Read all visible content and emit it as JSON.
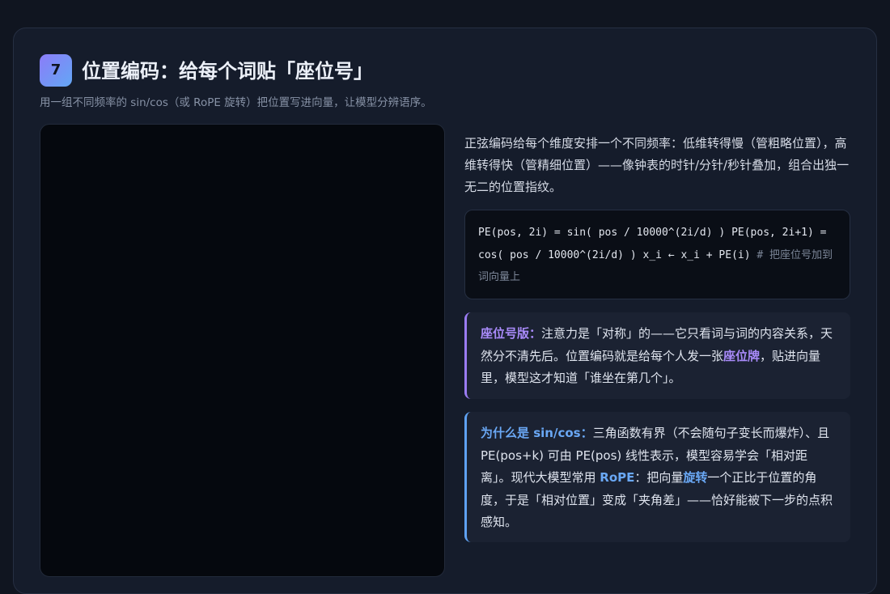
{
  "section": {
    "number": "7",
    "title": "位置编码：给每个词贴「座位号」",
    "subtitle": "用一组不同频率的 sin/cos（或 RoPE 旋转）把位置写进向量，让模型分辨语序。"
  },
  "intro_text": "正弦编码给每个维度安排一个不同频率：低维转得慢（管粗略位置），高维转得快（管精细位置）——像钟表的时针/分针/秒针叠加，组合出独一无二的位置指纹。",
  "code": {
    "formula": "PE(pos, 2i) = sin( pos / 10000^(2i/d) ) PE(pos, 2i+1) = cos( pos / 10000^(2i/d) ) x_i ← x_i + PE(i)",
    "comment": "# 把座位号加到词向量上"
  },
  "note_seat": {
    "label": "座位号版：",
    "text_1": "注意力是「对称」的——它只看词与词的内容关系，天然分不清先后。位置编码就是给每个人发一张",
    "highlight": "座位牌",
    "text_2": "，贴进向量里，模型这才知道「谁坐在第几个」。"
  },
  "note_why": {
    "label": "为什么是 sin/cos：",
    "text_1": "三角函数有界（不会随句子变长而爆炸）、且 PE(pos+k) 可由 PE(pos) 线性表示，模型容易学会「相对距离」。现代大模型常用 ",
    "highlight_rope": "RoPE",
    "text_2": "：把向量",
    "highlight_rotate": "旋转",
    "text_3": "一个正比于位置的角度，于是「相对位置」变成「夹角差」——恰好能被下一步的点积感知。"
  },
  "colors": {
    "accent_purple": "#9b7cf4",
    "accent_blue": "#5fa2f3",
    "card_bg": "#151c2b",
    "canvas_bg": "#05080e"
  }
}
